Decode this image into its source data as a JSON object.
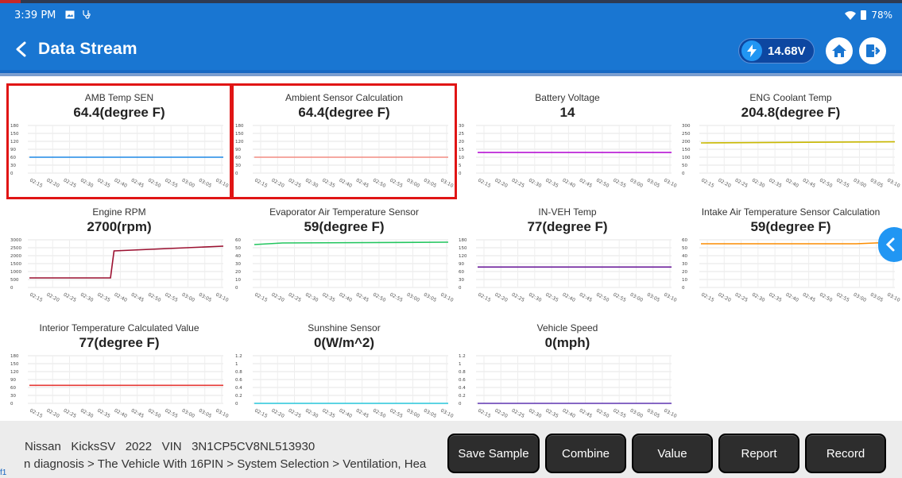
{
  "status_bar": {
    "time": "3:39 PM",
    "battery_percent": "78%"
  },
  "header": {
    "title": "Data Stream",
    "voltage": "14.68V"
  },
  "x_ticks": [
    "02:15",
    "02:20",
    "02:25",
    "02:30",
    "02:35",
    "02:40",
    "02:45",
    "02:50",
    "02:55",
    "03:00",
    "03:05",
    "03:10"
  ],
  "panels": [
    {
      "name": "AMB Temp SEN",
      "value": "64.4(degree F)",
      "selected": true,
      "color": "#1e88e5",
      "yticks": [
        "180",
        "150",
        "120",
        "90",
        "60",
        "30",
        "0"
      ]
    },
    {
      "name": "Ambient Sensor Calculation",
      "value": "64.4(degree F)",
      "selected": true,
      "color": "#f28b82",
      "yticks": [
        "180",
        "150",
        "120",
        "90",
        "60",
        "30",
        "0"
      ]
    },
    {
      "name": "Battery Voltage",
      "value": "14",
      "selected": false,
      "color": "#b000d0",
      "yticks": [
        "30",
        "25",
        "20",
        "15",
        "10",
        "5",
        "0"
      ]
    },
    {
      "name": "ENG Coolant Temp",
      "value": "204.8(degree F)",
      "selected": false,
      "color": "#c9b800",
      "yticks": [
        "300",
        "250",
        "200",
        "150",
        "100",
        "50",
        "0"
      ]
    },
    {
      "name": "Engine RPM",
      "value": "2700(rpm)",
      "selected": false,
      "color": "#9c1131",
      "yticks": [
        "3000",
        "2500",
        "2000",
        "1500",
        "1000",
        "500",
        "0"
      ]
    },
    {
      "name": "Evaporator Air Temperature Sensor",
      "value": "59(degree F)",
      "selected": false,
      "color": "#22c55e",
      "yticks": [
        "60",
        "50",
        "40",
        "30",
        "20",
        "10",
        "0"
      ]
    },
    {
      "name": "IN-VEH Temp",
      "value": "77(degree F)",
      "selected": false,
      "color": "#6a1b9a",
      "yticks": [
        "180",
        "150",
        "120",
        "90",
        "60",
        "30",
        "0"
      ]
    },
    {
      "name": "Intake Air Temperature Sensor Calculation",
      "value": "59(degree F)",
      "selected": false,
      "color": "#fb8c00",
      "yticks": [
        "60",
        "50",
        "40",
        "30",
        "20",
        "10",
        "0"
      ]
    },
    {
      "name": "Interior Temperature Calculated Value",
      "value": "77(degree F)",
      "selected": false,
      "color": "#e53935",
      "yticks": [
        "180",
        "150",
        "120",
        "90",
        "60",
        "30",
        "0"
      ]
    },
    {
      "name": "Sunshine Sensor",
      "value": "0(W/m^2)",
      "selected": false,
      "color": "#26c6da",
      "yticks": [
        "1.2",
        "1",
        "0.8",
        "0.6",
        "0.4",
        "0.2",
        "0"
      ]
    },
    {
      "name": "Vehicle Speed",
      "value": "0(mph)",
      "selected": false,
      "color": "#5e35b1",
      "yticks": [
        "1.2",
        "1",
        "0.8",
        "0.6",
        "0.4",
        "0.2",
        "0"
      ]
    }
  ],
  "chart_data": [
    {
      "type": "line",
      "title": "AMB Temp SEN",
      "ylim": [
        0,
        180
      ],
      "x": [
        "02:15",
        "03:10"
      ],
      "series": [
        {
          "values": [
            60,
            60
          ]
        }
      ]
    },
    {
      "type": "line",
      "title": "Ambient Sensor Calculation",
      "ylim": [
        0,
        180
      ],
      "x": [
        "02:15",
        "03:10"
      ],
      "series": [
        {
          "values": [
            60,
            60
          ]
        }
      ]
    },
    {
      "type": "line",
      "title": "Battery Voltage",
      "ylim": [
        0,
        30
      ],
      "x": [
        "02:15",
        "03:10"
      ],
      "series": [
        {
          "values": [
            13,
            13
          ]
        }
      ]
    },
    {
      "type": "line",
      "title": "ENG Coolant Temp",
      "ylim": [
        0,
        300
      ],
      "x": [
        "02:15",
        "03:10"
      ],
      "series": [
        {
          "values": [
            190,
            197
          ]
        }
      ]
    },
    {
      "type": "line",
      "title": "Engine RPM",
      "ylim": [
        0,
        3000
      ],
      "x": [
        "02:15",
        "02:38",
        "02:39",
        "03:10"
      ],
      "series": [
        {
          "values": [
            600,
            600,
            2300,
            2600
          ]
        }
      ]
    },
    {
      "type": "line",
      "title": "Evaporator Air Temperature Sensor",
      "ylim": [
        0,
        60
      ],
      "x": [
        "02:15",
        "02:23",
        "03:10"
      ],
      "series": [
        {
          "values": [
            54,
            56,
            57
          ]
        }
      ]
    },
    {
      "type": "line",
      "title": "IN-VEH Temp",
      "ylim": [
        0,
        180
      ],
      "x": [
        "02:15",
        "03:10"
      ],
      "series": [
        {
          "values": [
            77,
            77
          ]
        }
      ]
    },
    {
      "type": "line",
      "title": "Intake Air Temperature Sensor Calculation",
      "ylim": [
        0,
        60
      ],
      "x": [
        "02:15",
        "02:59",
        "03:10"
      ],
      "series": [
        {
          "values": [
            55,
            55,
            57
          ]
        }
      ]
    },
    {
      "type": "line",
      "title": "Interior Temperature Calculated Value",
      "ylim": [
        0,
        180
      ],
      "x": [
        "02:15",
        "03:10"
      ],
      "series": [
        {
          "values": [
            68,
            68
          ]
        }
      ]
    },
    {
      "type": "line",
      "title": "Sunshine Sensor",
      "ylim": [
        0,
        1.2
      ],
      "x": [
        "02:15",
        "03:10"
      ],
      "series": [
        {
          "values": [
            0,
            0
          ]
        }
      ]
    },
    {
      "type": "line",
      "title": "Vehicle Speed",
      "ylim": [
        0,
        1.2
      ],
      "x": [
        "02:15",
        "03:10"
      ],
      "series": [
        {
          "values": [
            0,
            0
          ]
        }
      ]
    }
  ],
  "footer": {
    "vehicle_info": "Nissan   KicksSV   2022   VIN   3N1CP5CV8NL513930",
    "breadcrumb": "n diagnosis > The Vehicle With 16PIN > System Selection > Ventilation, Hea",
    "corner_mark": "f1"
  },
  "buttons": {
    "save_sample": "Save Sample",
    "combine": "Combine",
    "value": "Value",
    "report": "Report",
    "record": "Record"
  },
  "colors": {
    "header_blue": "#1976d2",
    "selection_red": "#e01515",
    "button_dark": "#2d2d2d"
  }
}
